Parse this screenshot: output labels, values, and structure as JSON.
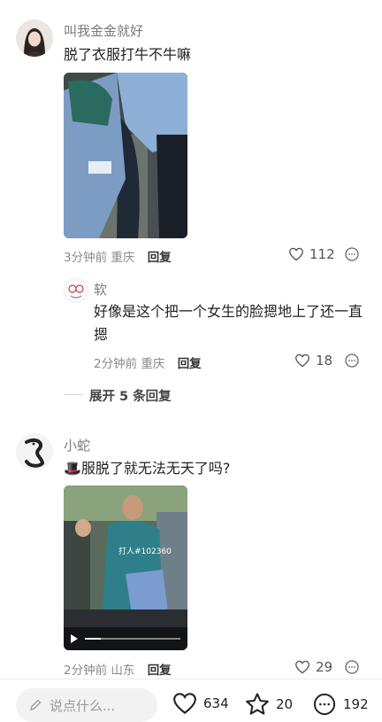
{
  "comments": [
    {
      "username": "叫我金金就好",
      "text": "脱了衣服打牛不牛嘛",
      "time": "3分钟前",
      "location": "重庆",
      "reply_label": "回复",
      "likes": "112",
      "reply": {
        "username": "软",
        "text_line1": "好像是这个把一个女生的脸摁地上了还一直",
        "text_line2": "摁",
        "time": "2分钟前",
        "location": "重庆",
        "reply_label": "回复",
        "likes": "18"
      },
      "expand_label": "展开 5 条回复"
    },
    {
      "username": "小蛇",
      "emoji": "🎩",
      "text": "服脱了就无法无天了吗?",
      "time": "2分钟前",
      "location": "山东",
      "reply_label": "回复",
      "likes": "29",
      "image_caption": "打人#102360"
    }
  ],
  "bottom_bar": {
    "input_placeholder": "说点什么...",
    "like_count": "634",
    "star_count": "20",
    "comment_count": "192"
  },
  "colors": {
    "background": "#ffffff",
    "name": "#7a7a7a",
    "meta": "#8a8a8a",
    "text": "#222222"
  }
}
